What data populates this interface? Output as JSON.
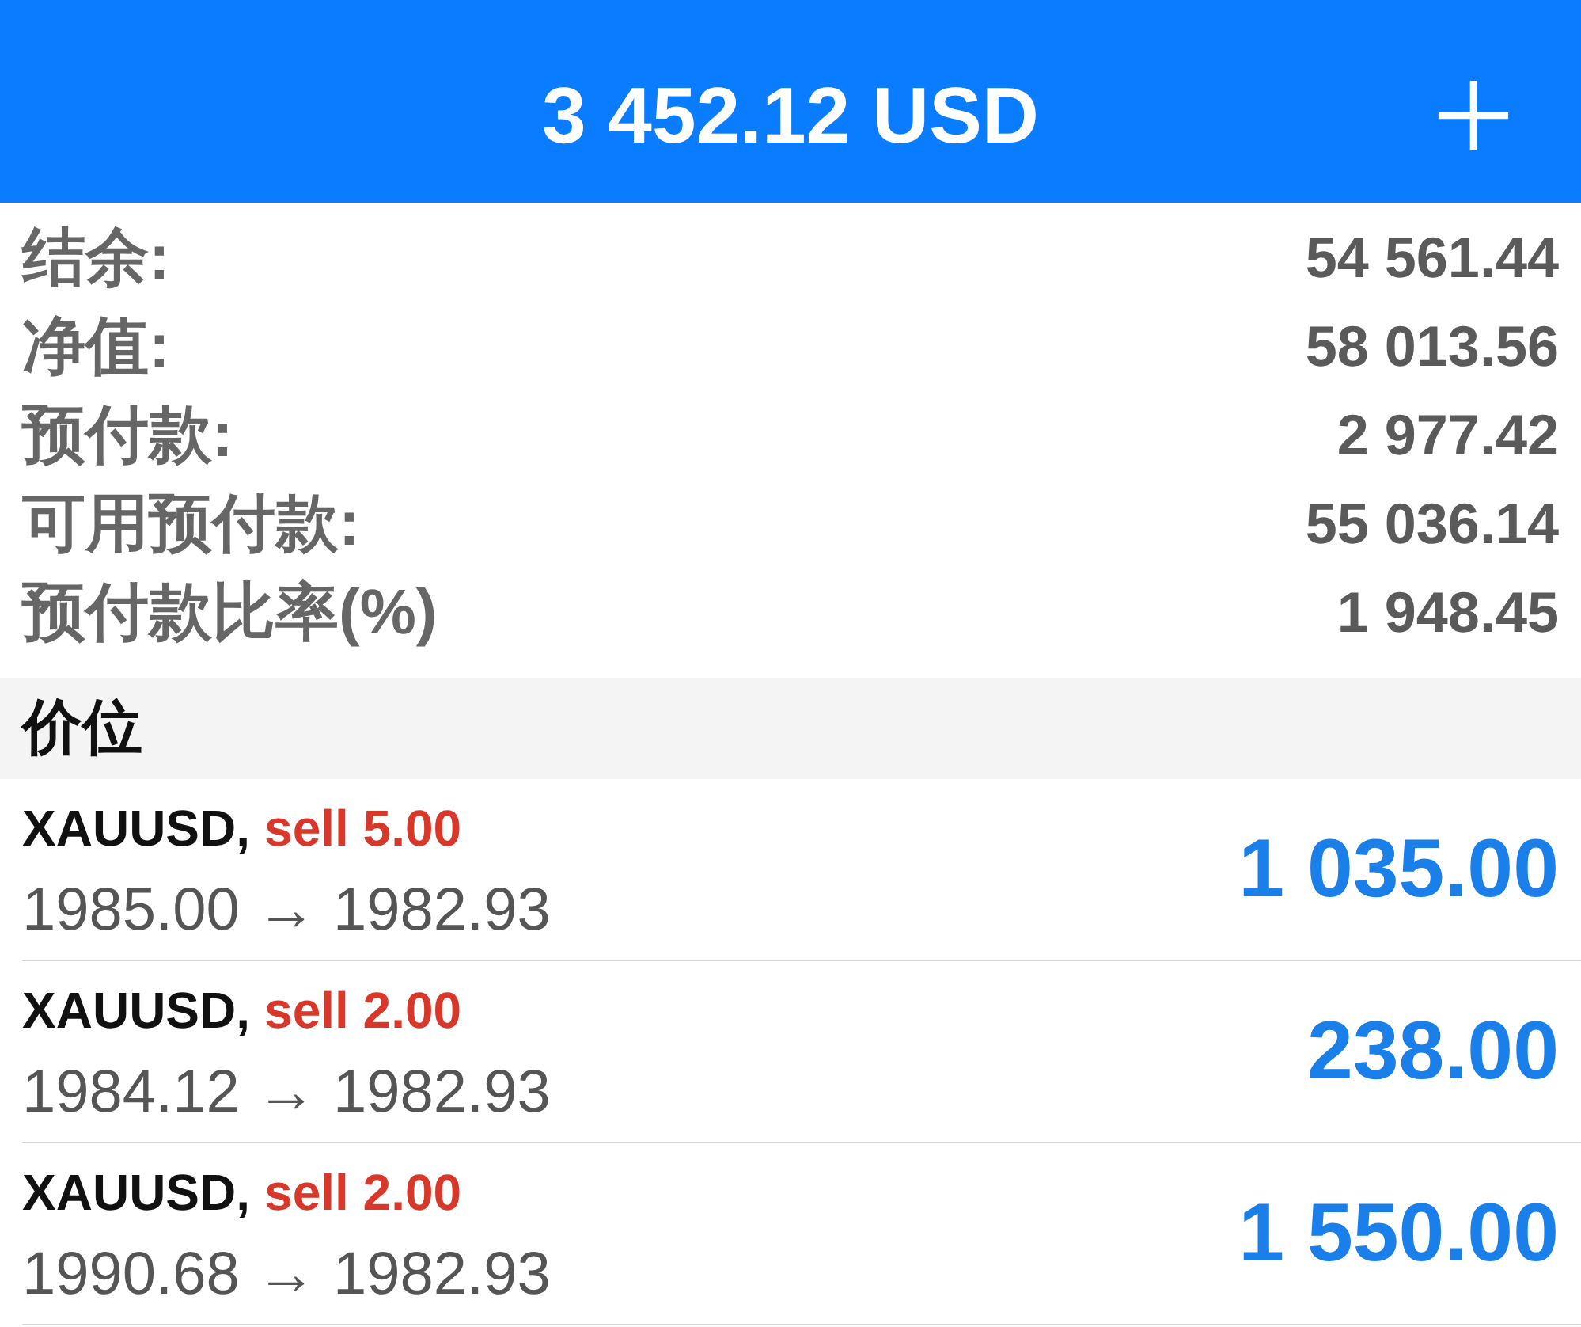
{
  "header": {
    "title": "3 452.12 USD"
  },
  "summary": [
    {
      "label": "结余:",
      "value": "54 561.44"
    },
    {
      "label": "净值:",
      "value": "58 013.56"
    },
    {
      "label": "预付款:",
      "value": "2 977.42"
    },
    {
      "label": "可用预付款:",
      "value": "55 036.14"
    },
    {
      "label": "预付款比率(%)",
      "value": "1 948.45"
    }
  ],
  "positions_section": {
    "title": "价位"
  },
  "positions": [
    {
      "symbol": "XAUUSD,",
      "side": "sell",
      "volume": "5.00",
      "prices": "1985.00 → 1982.93",
      "profit": "1 035.00"
    },
    {
      "symbol": "XAUUSD,",
      "side": "sell",
      "volume": "2.00",
      "prices": "1984.12 → 1982.93",
      "profit": "238.00"
    },
    {
      "symbol": "XAUUSD,",
      "side": "sell",
      "volume": "2.00",
      "prices": "1990.68 → 1982.93",
      "profit": "1 550.00"
    }
  ]
}
